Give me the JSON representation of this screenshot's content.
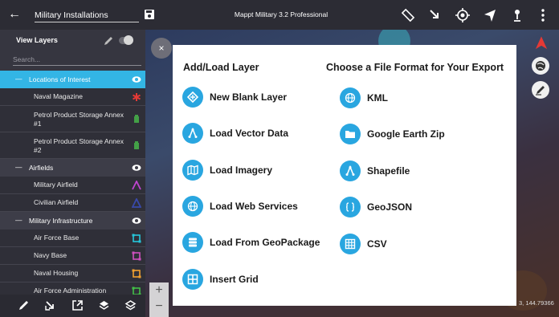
{
  "topbar": {
    "project_name": "Military Installations",
    "app_title": "Mappt Military 3.2 Professional"
  },
  "sidebar": {
    "title": "View Layers",
    "search_placeholder": "Search...",
    "groups": [
      {
        "name": "Locations of Interest",
        "items": [
          {
            "name": "Naval Magazine",
            "icon": "asterisk-icon",
            "color": "#e53935"
          },
          {
            "name": "Petrol Product Storage Annex #1",
            "icon": "battery-icon",
            "color": "#43a047"
          },
          {
            "name": "Petrol Product Storage Annex #2",
            "icon": "battery-icon",
            "color": "#43a047"
          }
        ]
      },
      {
        "name": "Airfields",
        "items": [
          {
            "name": "Military Airfield",
            "icon": "polyline-icon",
            "color": "#c044d0"
          },
          {
            "name": "Civilian Airfield",
            "icon": "triangle-icon",
            "color": "#3949ab"
          }
        ]
      },
      {
        "name": "Military Infrastructure",
        "items": [
          {
            "name": "Air Force Base",
            "icon": "polygon-icon",
            "color": "#26c6da"
          },
          {
            "name": "Navy Base",
            "icon": "polygon-icon",
            "color": "#d050c0"
          },
          {
            "name": "Naval Housing",
            "icon": "polygon-icon",
            "color": "#f0a030"
          },
          {
            "name": "Air Force Administration",
            "icon": "polygon-icon",
            "color": "#43c047"
          }
        ]
      }
    ]
  },
  "panel": {
    "left_heading": "Add/Load Layer",
    "right_heading": "Choose a File Format for Your Export",
    "left_options": [
      "New Blank Layer",
      "Load Vector Data",
      "Load Imagery",
      "Load Web Services",
      "Load From GeoPackage",
      "Insert Grid"
    ],
    "right_options": [
      "KML",
      "Google Earth Zip",
      "Shapefile",
      "GeoJSON",
      "CSV"
    ]
  },
  "map": {
    "coordinates": "3, 144.79366",
    "accent": "#29a6e0"
  }
}
